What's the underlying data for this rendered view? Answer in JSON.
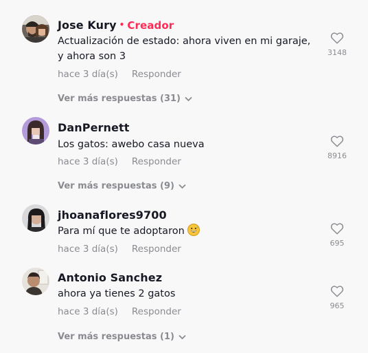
{
  "comments": [
    {
      "username": "Jose Kury",
      "badge": "Creador",
      "text": "Actualización de estado: ahora viven en mi garaje, y ahora son 3",
      "time": "hace 3 día(s)",
      "reply_label": "Responder",
      "likes": "3148",
      "more_replies": "Ver más respuestas (31)"
    },
    {
      "username": "DanPernett",
      "text": "Los gatos: awebo casa nueva",
      "time": "hace 3 día(s)",
      "reply_label": "Responder",
      "likes": "8916",
      "more_replies": "Ver más respuestas (9)"
    },
    {
      "username": "jhoanaflores9700",
      "text": "Para mí que te adoptaron",
      "emoji": "grinning-sweat-emoji",
      "time": "hace 3 día(s)",
      "reply_label": "Responder",
      "likes": "695"
    },
    {
      "username": "Antonio Sanchez",
      "text": "ahora ya tienes 2 gatos",
      "time": "hace 3 día(s)",
      "reply_label": "Responder",
      "likes": "965",
      "more_replies": "Ver más respuestas (1)"
    }
  ],
  "colors": {
    "creator_badge": "#fe2c55",
    "muted_text": "#8a8b91",
    "primary_text": "#161823",
    "background": "#f8f8f8"
  },
  "icons": {
    "like": "heart-outline-icon",
    "expand": "chevron-down-icon"
  }
}
